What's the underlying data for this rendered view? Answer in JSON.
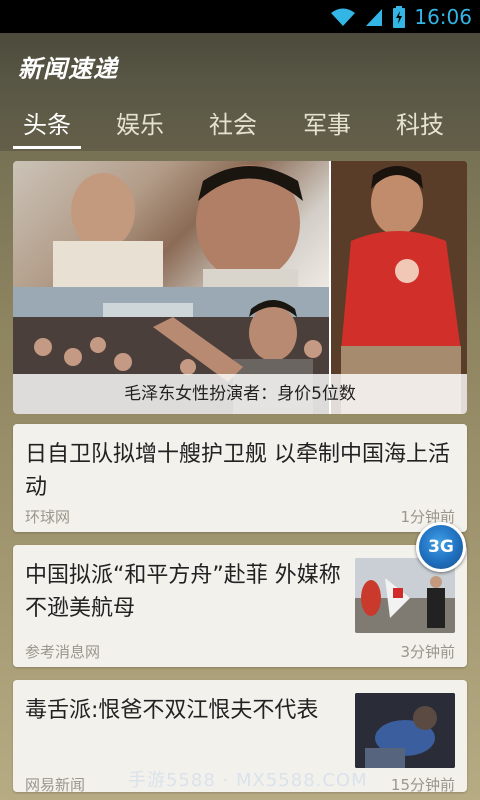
{
  "status_bar": {
    "time": "16:06",
    "wifi_icon": "wifi-icon",
    "signal_icon": "signal-icon",
    "battery_icon": "battery-charging-icon"
  },
  "app": {
    "title": "新闻速递"
  },
  "tabs": [
    {
      "label": "头条",
      "active": true
    },
    {
      "label": "娱乐",
      "active": false
    },
    {
      "label": "社会",
      "active": false
    },
    {
      "label": "军事",
      "active": false
    },
    {
      "label": "科技",
      "active": false
    }
  ],
  "hero": {
    "caption": "毛泽东女性扮演者：身价5位数"
  },
  "articles": [
    {
      "title": "日自卫队拟增十艘护卫舰 以牵制中国海上活动",
      "source": "环球网",
      "time": "1分钟前"
    },
    {
      "title": "中国拟派“和平方舟”赴菲 外媒称不逊美航母",
      "source": "参考消息网",
      "time": "3分钟前"
    },
    {
      "title": "毒舌派:恨爸不双江恨夫不代表",
      "source": "网易新闻",
      "time": "15分钟前"
    }
  ],
  "badge": {
    "label": "3G"
  },
  "watermark": "手游5588 · MX5588.COM",
  "colors": {
    "status_accent": "#33b5e5",
    "card_bg": "#f3f1ec",
    "badge_blue": "#1f6fbe"
  }
}
